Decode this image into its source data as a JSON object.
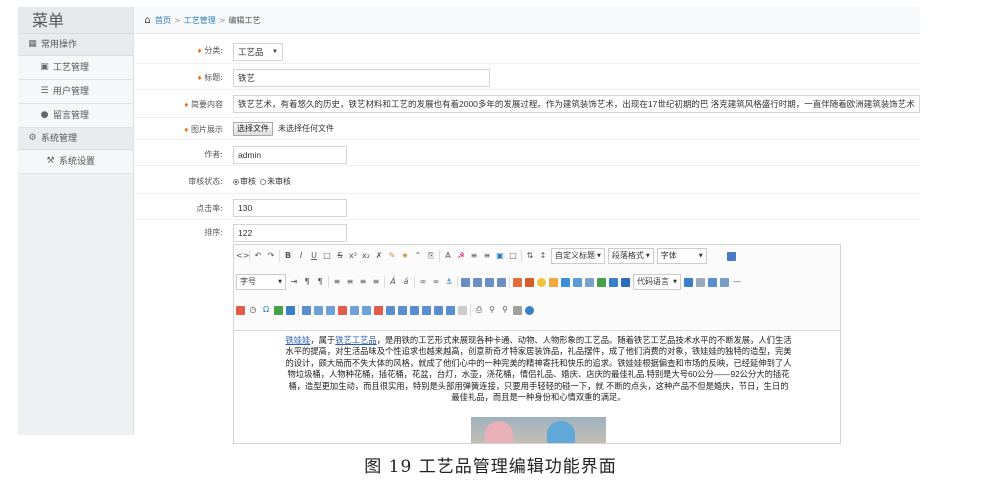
{
  "sidebar": {
    "title": "菜单",
    "groups": [
      {
        "label": "常用操作",
        "items": [
          {
            "label": "工艺管理"
          },
          {
            "label": "用户管理"
          },
          {
            "label": "留言管理"
          }
        ]
      },
      {
        "label": "系统管理",
        "items": [
          {
            "label": "系统设置"
          }
        ]
      }
    ]
  },
  "breadcrumb": {
    "home": "首页",
    "section": "工艺管理",
    "current": "编辑工艺",
    "separator": ">"
  },
  "form": {
    "category": {
      "label": "分类:",
      "value": "工艺品"
    },
    "title": {
      "label": "标题:",
      "value": "铁艺"
    },
    "summary": {
      "label": "简要内容",
      "value": "铁艺艺术，有着悠久的历史，铁艺材料和工艺的发展也有着2000多年的发展过程。作为建筑装饰艺术，出现在17世纪初期的巴 洛克建筑风格盛行时期，一直伴随着欧洲建筑装饰艺术"
    },
    "image": {
      "label": "图片展示",
      "button": "选择文件",
      "note": "未选择任何文件"
    },
    "author": {
      "label": "作者:",
      "value": "admin"
    },
    "status": {
      "label": "审核状态:",
      "option_approved": "审核",
      "option_pending": "未审核",
      "selected": "审核"
    },
    "hits": {
      "label": "点击率:",
      "value": "130"
    },
    "order": {
      "label": "排序:",
      "value": "122"
    }
  },
  "editor": {
    "toolbar": {
      "custom_title": "自定义标题",
      "paragraph": "段落格式",
      "font_family": "字体",
      "font_size": "字号",
      "code_lang": "代码语言"
    },
    "content": {
      "kw1": "铁娃娃",
      "t1": "，属于",
      "kw2": "铁艺工艺品",
      "t2": "，是用铁的工艺形式来展现各种卡通、动物、人物形象的工艺品。随着铁艺工艺品技术水平的不断发展，人们生活",
      "line2": "水平的提高，对生活品味及个性追求也越来越高，创意新奇才特家居装饰品，礼品摆件，成了他们消费的对象，铁娃娃的独特的造型，完美",
      "line3": "的设计，颇大局而不失大体的风格，就成了他们心中的一种完美的精神寄托和快乐的追求。铁娃娃根据偏查和市场的反映，已经延伸到了人",
      "line4": "物垃圾桶，人物种花桶，插花桶，花盆，台灯，水壶，浇花桶，情侣礼品、婚庆、店庆的最佳礼品.特别是大号60公分——92公分大的插花",
      "line5": "桶，造型更加生动，而且很实用，特别是头部用弹簧连接，只要用手轻轻的碰一下，就 不断的点头，这种产品不但是婚庆，节日，生日的",
      "line6": "最佳礼品，而且是一种身份和心情双重的满足。"
    }
  },
  "caption": "图 19 工艺品管理编辑功能界面"
}
